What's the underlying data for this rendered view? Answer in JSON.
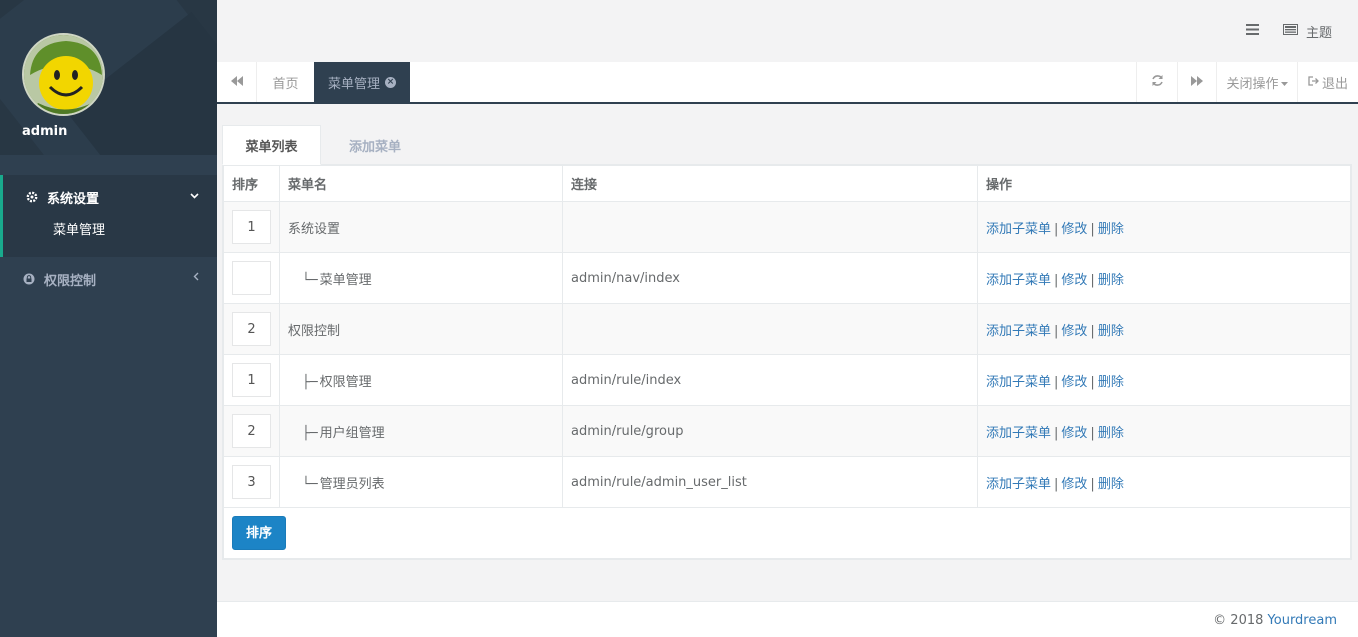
{
  "sidebar": {
    "username": "admin",
    "menu": [
      {
        "label": "系统设置",
        "icon": "gear-icon",
        "children": [
          "菜单管理"
        ]
      },
      {
        "label": "权限控制",
        "icon": "lock-icon",
        "children": []
      }
    ]
  },
  "topbar": {
    "theme_label": "主题"
  },
  "tabs": {
    "home": "首页",
    "current": "菜单管理",
    "close_ops": "关闭操作",
    "logout": "退出"
  },
  "content": {
    "tab_list": "菜单列表",
    "tab_add": "添加菜单",
    "columns": [
      "排序",
      "菜单名",
      "连接",
      "操作"
    ],
    "rows": [
      {
        "order": "1",
        "tree": "",
        "name": "系统设置",
        "link": ""
      },
      {
        "order": "",
        "tree": "└─",
        "name": "菜单管理",
        "link": "admin/nav/index"
      },
      {
        "order": "2",
        "tree": "",
        "name": "权限控制",
        "link": ""
      },
      {
        "order": "1",
        "tree": "├─",
        "name": "权限管理",
        "link": "admin/rule/index"
      },
      {
        "order": "2",
        "tree": "├─",
        "name": "用户组管理",
        "link": "admin/rule/group"
      },
      {
        "order": "3",
        "tree": "└─",
        "name": "管理员列表",
        "link": "admin/rule/admin_user_list"
      }
    ],
    "actions": {
      "add_child": "添加子菜单",
      "edit": "修改",
      "delete": "删除",
      "separator": "|"
    },
    "sort_button": "排序"
  },
  "footer": {
    "copyright": "© 2018",
    "brand": "Yourdream"
  },
  "colors": {
    "sidebar_bg": "#2f4050",
    "accent": "#19aa8d",
    "primary": "#1c84c6",
    "link": "#337ab7"
  }
}
